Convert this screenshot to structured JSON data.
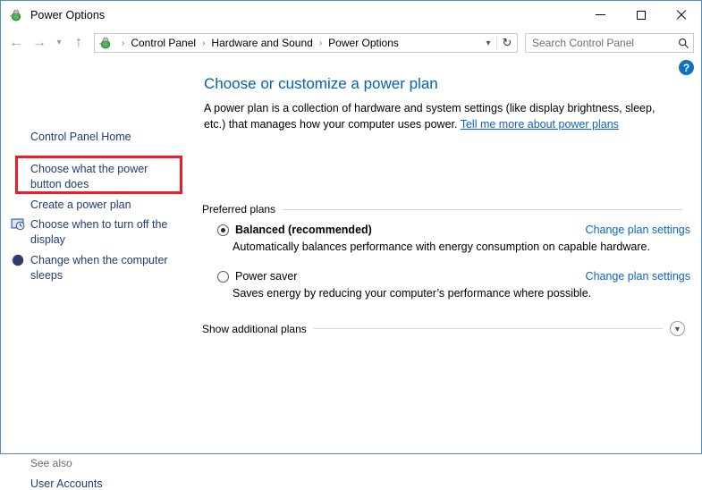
{
  "window": {
    "title": "Power Options",
    "icon": "power-plug-battery-icon",
    "controls": {
      "minimize": "minimize-icon",
      "maximize": "maximize-icon",
      "close": "close-icon"
    }
  },
  "navbar": {
    "back": "back-arrow-icon",
    "forward": "forward-arrow-icon",
    "recent": "chevron-down-icon",
    "up": "up-arrow-icon",
    "address_icon": "power-plug-battery-icon",
    "breadcrumbs": [
      "Control Panel",
      "Hardware and Sound",
      "Power Options"
    ],
    "separator": "›",
    "dropdown": "chevron-down-icon",
    "refresh": "↻",
    "search": {
      "placeholder": "Search Control Panel",
      "icon": "search-icon"
    }
  },
  "help": {
    "label": "?",
    "color": "#0f72c0"
  },
  "sidebar": {
    "items": [
      {
        "label": "Control Panel Home",
        "icon": null,
        "highlighted": false
      },
      {
        "label": "Choose what the power button does",
        "icon": null,
        "highlighted": true
      },
      {
        "label": "Create a power plan",
        "icon": null,
        "highlighted": false
      },
      {
        "label": "Choose when to turn off the display",
        "icon": "monitor-clock-icon",
        "highlighted": false
      },
      {
        "label": "Change when the computer sleeps",
        "icon": "moon-sleep-icon",
        "highlighted": false
      }
    ],
    "highlight_color": "#ee1c25",
    "see_also_label": "See also",
    "see_also_items": [
      "User Accounts"
    ]
  },
  "main": {
    "title": "Choose or customize a power plan",
    "description_part1": "A power plan is a collection of hardware and system settings (like display brightness, sleep, etc.) that manages how your computer uses power. ",
    "description_link": "Tell me more about power plans",
    "preferred_plans_label": "Preferred plans",
    "plans": [
      {
        "name": "Balanced (recommended)",
        "selected": true,
        "bold": true,
        "description": "Automatically balances performance with energy consumption on capable hardware.",
        "link": "Change plan settings"
      },
      {
        "name": "Power saver",
        "selected": false,
        "bold": false,
        "description": "Saves energy by reducing your computer’s performance where possible.",
        "link": "Change plan settings"
      }
    ],
    "show_additional_label": "Show additional plans",
    "show_additional_icon": "chevron-down-icon"
  }
}
